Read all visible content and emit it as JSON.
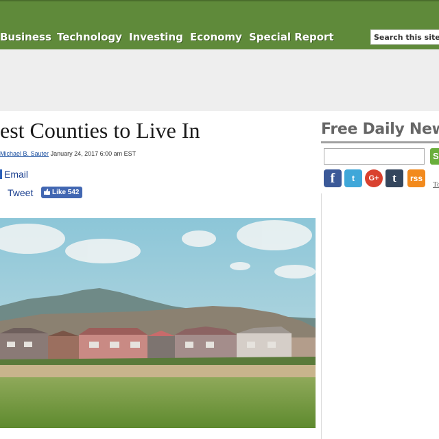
{
  "nav": {
    "items": [
      "Business",
      "Technology",
      "Investing",
      "Economy",
      "Special Report"
    ],
    "search_placeholder": "Search this site"
  },
  "article": {
    "title": "est Counties to Live In",
    "author": "Michael B. Sauter",
    "date": "January 24, 2017 6:00 am EST",
    "email_label": "Email",
    "tweet_label": "Tweet",
    "like_label": "Like 542"
  },
  "sidebar": {
    "newsletter_heading": "Free Daily New",
    "submit_label": "S",
    "social_icons": [
      "facebook-icon",
      "twitter-icon",
      "google-plus-icon",
      "tumblr-icon",
      "rss-icon"
    ],
    "facebook_glyph": "f",
    "twitter_glyph": "t",
    "google_glyph": "G+",
    "tumblr_glyph": "t",
    "rss_glyph": "rss",
    "partial_link": "To"
  },
  "colors": {
    "nav_bg": "#5f8a3a",
    "ad_band": "#eeeeee",
    "link_blue": "#1a3f8f",
    "facebook": "#3b5998",
    "twitter": "#3fa7d9",
    "google": "#d9412f",
    "tumblr": "#34465d",
    "rss": "#f28a1d"
  }
}
